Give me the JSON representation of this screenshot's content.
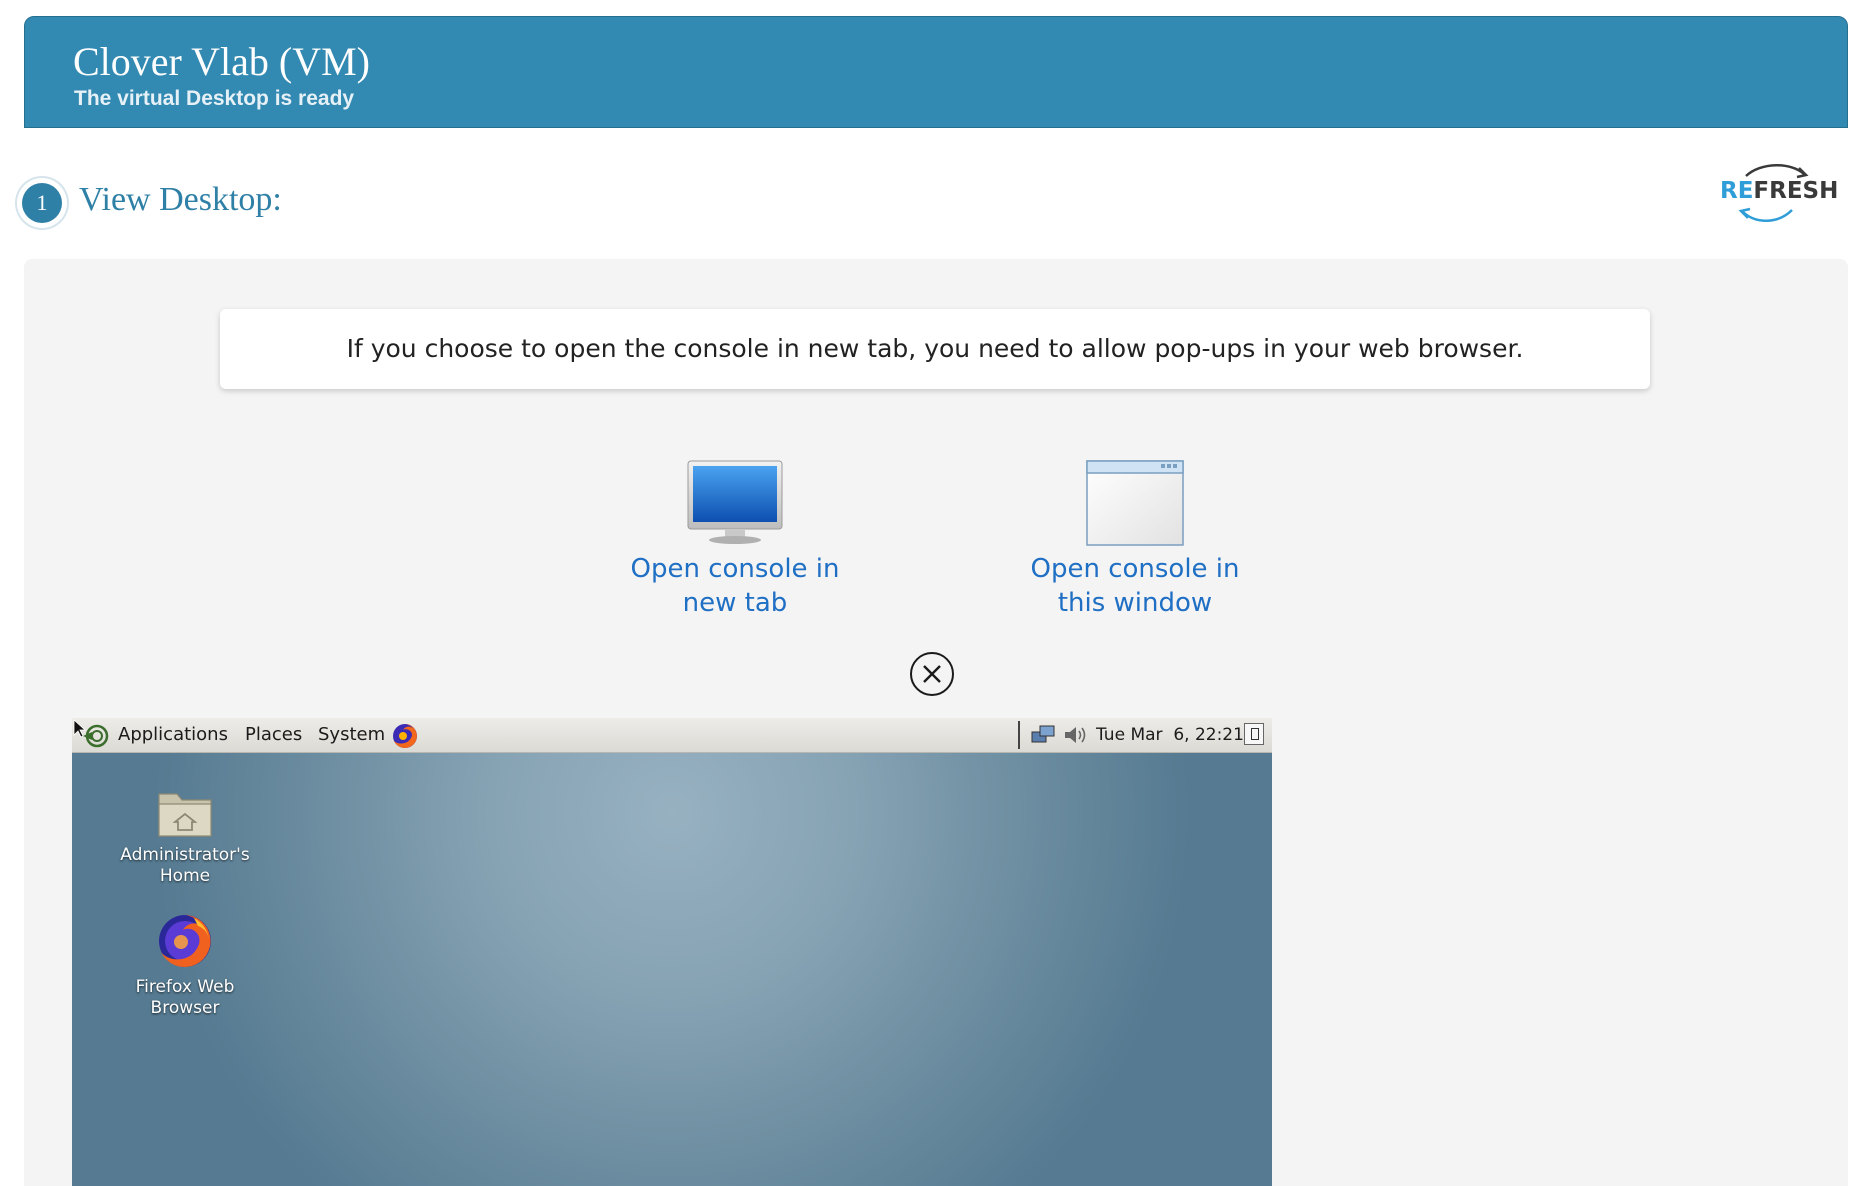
{
  "header": {
    "title": "Clover Vlab (VM)",
    "subtitle": "The virtual Desktop is ready",
    "color": "#3289b1"
  },
  "step": {
    "number": "1",
    "title": "View Desktop:"
  },
  "refresh": {
    "label_a": "RE",
    "label_b": "FRESH"
  },
  "notice": "If you choose to open the console in new tab, you need to allow pop-ups in your web browser.",
  "console_options": {
    "new_tab": {
      "line1": "Open console in",
      "line2": "new tab",
      "icon": "monitor-icon"
    },
    "this_window": {
      "line1": "Open console in",
      "line2": "this window",
      "icon": "window-icon"
    }
  },
  "vm": {
    "taskbar": {
      "menus": [
        "Applications",
        "Places",
        "System"
      ],
      "clock": "Tue Mar  6, 22:21"
    },
    "desktop_icons": [
      {
        "label_line1": "Administrator's",
        "label_line2": "Home",
        "icon": "home-folder-icon"
      },
      {
        "label_line1": "Firefox Web",
        "label_line2": "Browser",
        "icon": "firefox-icon"
      }
    ]
  },
  "colors": {
    "link": "#1f6fc4",
    "accent": "#2f80a6"
  }
}
